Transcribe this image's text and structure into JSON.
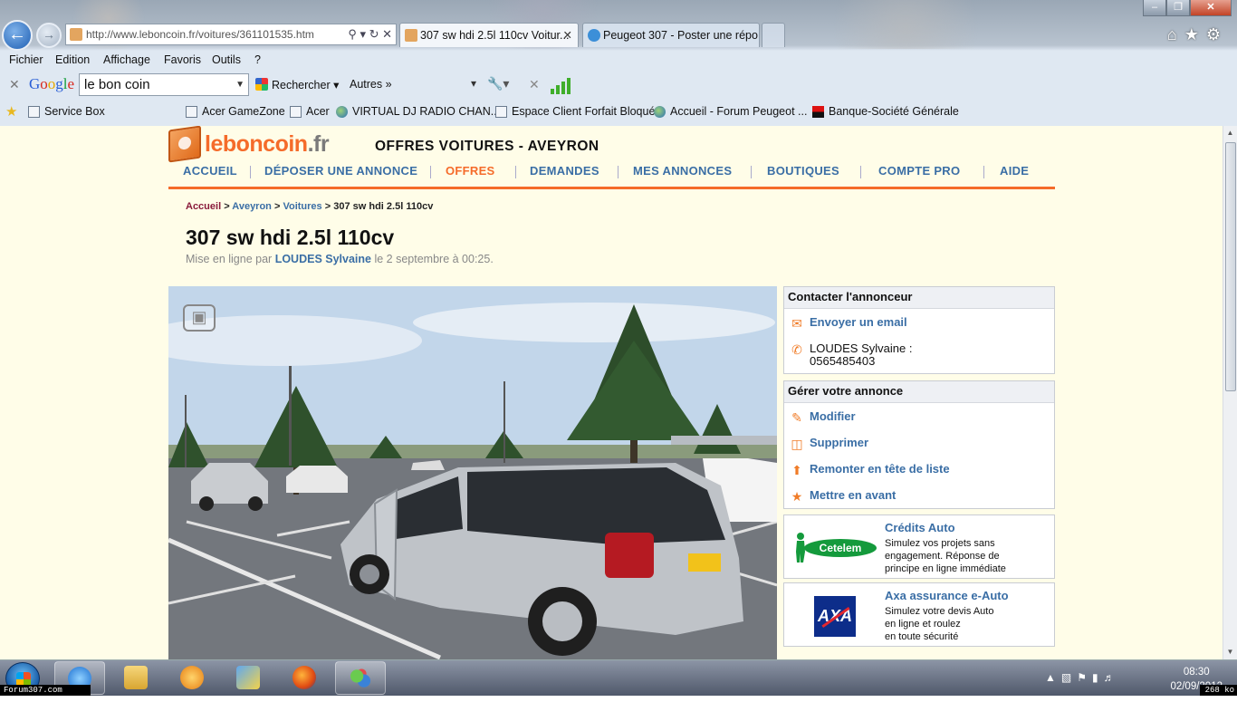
{
  "browser": {
    "address_url": "http://www.leboncoin.fr/voitures/361101535.htm",
    "tabs": [
      {
        "label": "307 sw hdi 2.5l 110cv Voitur..."
      },
      {
        "label": "Peugeot 307 - Poster une répo..."
      }
    ],
    "menu": [
      "Fichier",
      "Edition",
      "Affichage",
      "Favoris",
      "Outils",
      "?"
    ],
    "google_toolbar": {
      "logo_letters": [
        "G",
        "o",
        "o",
        "g",
        "l",
        "e"
      ],
      "search_value": "le bon coin",
      "search_button": "Rechercher",
      "more_label": "Autres »"
    },
    "favorites": [
      {
        "label": "Service Box",
        "icon": "ie-page-icon"
      },
      {
        "label": "Acer GameZone",
        "icon": "page-icon"
      },
      {
        "label": "Acer",
        "icon": "page-icon"
      },
      {
        "label": "VIRTUAL DJ RADIO CHAN...",
        "icon": "globe-icon"
      },
      {
        "label": "Espace Client Forfait Bloqué",
        "icon": "page-icon"
      },
      {
        "label": "Accueil - Forum Peugeot ...",
        "icon": "globe-icon"
      },
      {
        "label": "Banque-Société Générale",
        "icon": "sg-icon"
      }
    ]
  },
  "site": {
    "logo_primary": "leboncoin",
    "logo_suffix": ".fr",
    "section_title": "OFFRES VOITURES - AVEYRON",
    "nav": [
      {
        "label": "ACCUEIL",
        "active": false
      },
      {
        "label": "DÉPOSER UNE ANNONCE",
        "active": false
      },
      {
        "label": "OFFRES",
        "active": true
      },
      {
        "label": "DEMANDES",
        "active": false
      },
      {
        "label": "MES ANNONCES",
        "active": false
      },
      {
        "label": "BOUTIQUES",
        "active": false
      },
      {
        "label": "COMPTE PRO",
        "active": false
      },
      {
        "label": "AIDE",
        "active": false
      }
    ],
    "accent_color": "#f56b2a",
    "link_color": "#3a6ea5"
  },
  "breadcrumb": {
    "items": [
      "Accueil",
      "Aveyron",
      "Voitures"
    ],
    "separator": ">",
    "current": "307 sw hdi 2.5l 110cv"
  },
  "ad": {
    "title": "307 sw hdi 2.5l 110cv",
    "meta_prefix": "Mise en ligne par",
    "seller": "LOUDES Sylvaine",
    "meta_suffix": "le 2 septembre à 00:25."
  },
  "contact": {
    "heading": "Contacter l'annonceur",
    "email_label": "Envoyer un email",
    "phone_line1": "LOUDES Sylvaine :",
    "phone_line2": "0565485403"
  },
  "manage": {
    "heading": "Gérer votre annonce",
    "actions": [
      {
        "label": "Modifier",
        "icon": "pencil-icon"
      },
      {
        "label": "Supprimer",
        "icon": "trash-icon"
      },
      {
        "label": "Remonter en tête de liste",
        "icon": "arrow-up-icon"
      },
      {
        "label": "Mettre en avant",
        "icon": "star-icon"
      }
    ]
  },
  "promos": [
    {
      "title": "Crédits Auto",
      "logo_text": "Cetelem",
      "lines": [
        "Simulez vos projets sans",
        "engagement. Réponse de",
        "principe en ligne immédiate"
      ]
    },
    {
      "title": "Axa assurance e-Auto",
      "logo_text": "AXA",
      "lines": [
        "Simulez votre devis Auto",
        "en ligne et roulez",
        "en toute sécurité"
      ]
    }
  ],
  "taskbar": {
    "time": "08:30",
    "date": "02/09/2012",
    "watermark_left": "Forum307.com",
    "watermark_right": "268 ko"
  }
}
